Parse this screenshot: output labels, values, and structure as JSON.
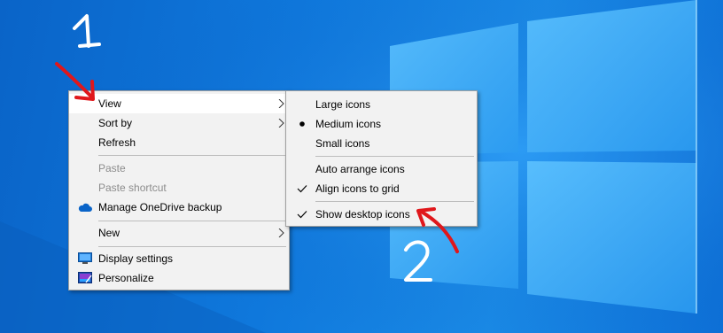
{
  "context_menu": {
    "items": [
      {
        "label": "View",
        "submenu": true,
        "state": "hover"
      },
      {
        "label": "Sort by",
        "submenu": true
      },
      {
        "label": "Refresh"
      },
      {
        "label": "Paste",
        "disabled": true
      },
      {
        "label": "Paste shortcut",
        "disabled": true
      },
      {
        "label": "Manage OneDrive backup",
        "icon": "onedrive-cloud-icon"
      },
      {
        "label": "New",
        "submenu": true
      },
      {
        "label": "Display settings",
        "icon": "display-monitor-icon"
      },
      {
        "label": "Personalize",
        "icon": "personalize-icon"
      }
    ]
  },
  "view_submenu": {
    "items": [
      {
        "label": "Large icons"
      },
      {
        "label": "Medium icons",
        "marker": "bullet"
      },
      {
        "label": "Small icons"
      },
      {
        "label": "Auto arrange icons"
      },
      {
        "label": "Align icons to grid",
        "marker": "check"
      },
      {
        "label": "Show desktop icons",
        "marker": "check"
      }
    ]
  },
  "annotations": {
    "step_1": "1",
    "step_2": "2",
    "annotation_color": "#e0171b"
  },
  "colors": {
    "desktop_blue": "#0f78dc",
    "menu_background": "#f2f2f2",
    "hover_background": "#ffffff",
    "disabled_text": "#8c8c8c"
  }
}
